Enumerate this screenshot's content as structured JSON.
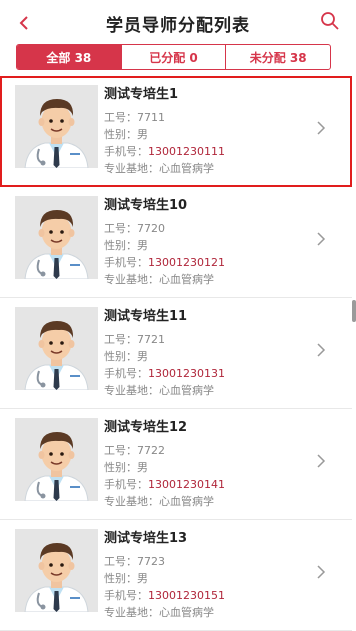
{
  "header": {
    "title": "学员导师分配列表"
  },
  "tabs": [
    {
      "label": "全部 38"
    },
    {
      "label": "已分配 0"
    },
    {
      "label": "未分配 38"
    }
  ],
  "labels": {
    "id": "工号：",
    "gender": "性别：",
    "phone": "手机号：",
    "base": "专业基地："
  },
  "students": [
    {
      "name": "测试专培生1",
      "id": "7711",
      "gender": "男",
      "phone": "13001230111",
      "base": "心血管病学"
    },
    {
      "name": "测试专培生10",
      "id": "7720",
      "gender": "男",
      "phone": "13001230121",
      "base": "心血管病学"
    },
    {
      "name": "测试专培生11",
      "id": "7721",
      "gender": "男",
      "phone": "13001230131",
      "base": "心血管病学"
    },
    {
      "name": "测试专培生12",
      "id": "7722",
      "gender": "男",
      "phone": "13001230141",
      "base": "心血管病学"
    },
    {
      "name": "测试专培生13",
      "id": "7723",
      "gender": "男",
      "phone": "13001230151",
      "base": "心血管病学"
    }
  ]
}
